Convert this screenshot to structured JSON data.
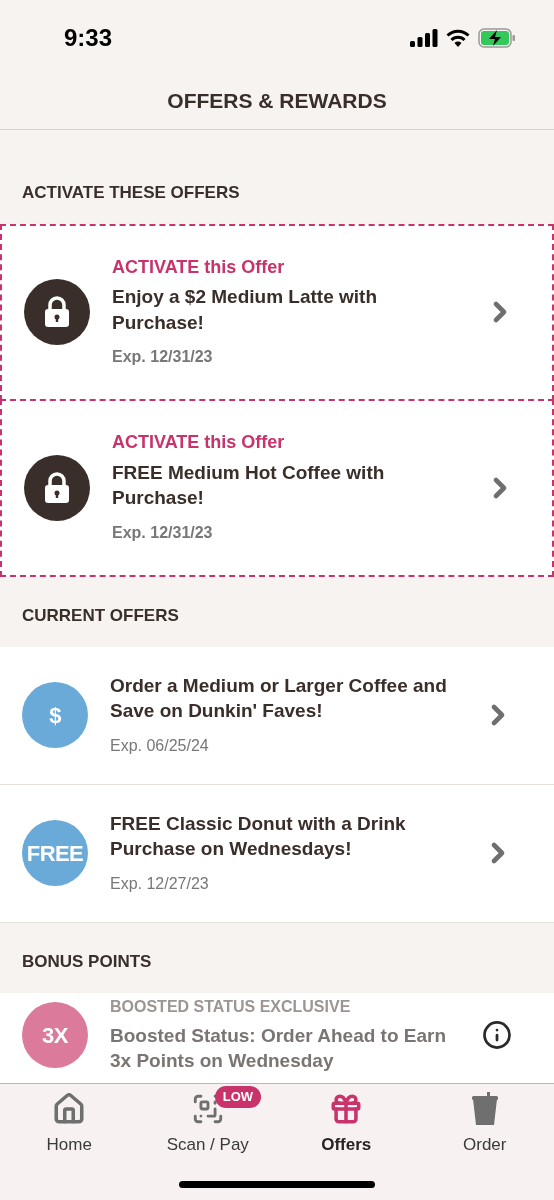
{
  "status_bar": {
    "time": "9:33"
  },
  "header": {
    "title": "OFFERS & REWARDS"
  },
  "sections": [
    {
      "heading": "ACTIVATE THESE OFFERS",
      "kind": "activate",
      "items": [
        {
          "label": "ACTIVATE this Offer",
          "title": "Enjoy a $2 Medium Latte with Purchase!",
          "expiry": "Exp. 12/31/23",
          "icon": {
            "kind": "lock"
          }
        },
        {
          "label": "ACTIVATE this Offer",
          "title": "FREE Medium Hot Coffee with Purchase!",
          "expiry": "Exp. 12/31/23",
          "icon": {
            "kind": "lock"
          }
        }
      ]
    },
    {
      "heading": "CURRENT OFFERS",
      "kind": "current",
      "items": [
        {
          "title": "Order a Medium or Larger Coffee and Save on Dunkin' Faves!",
          "expiry": "Exp. 06/25/24",
          "icon": {
            "kind": "text",
            "text": "$",
            "color": "#6aaad8"
          }
        },
        {
          "title": "FREE Classic Donut with a Drink Purchase on Wednesdays!",
          "expiry": "Exp. 12/27/23",
          "icon": {
            "kind": "text",
            "text": "FREE",
            "color": "#6aaad8"
          }
        }
      ]
    },
    {
      "heading": "BONUS POINTS",
      "kind": "bonus",
      "items": [
        {
          "label": "BOOSTED STATUS EXCLUSIVE",
          "title": "Boosted Status: Order Ahead to Earn 3x Points on Wednesday",
          "icon": {
            "kind": "text",
            "text": "3X",
            "color": "#dc7a9b"
          }
        }
      ]
    }
  ],
  "tab_bar": [
    {
      "label": "Home",
      "selected": false
    },
    {
      "label": "Scan / Pay",
      "selected": false,
      "badge": "LOW"
    },
    {
      "label": "Offers",
      "selected": true
    },
    {
      "label": "Order",
      "selected": false
    }
  ]
}
